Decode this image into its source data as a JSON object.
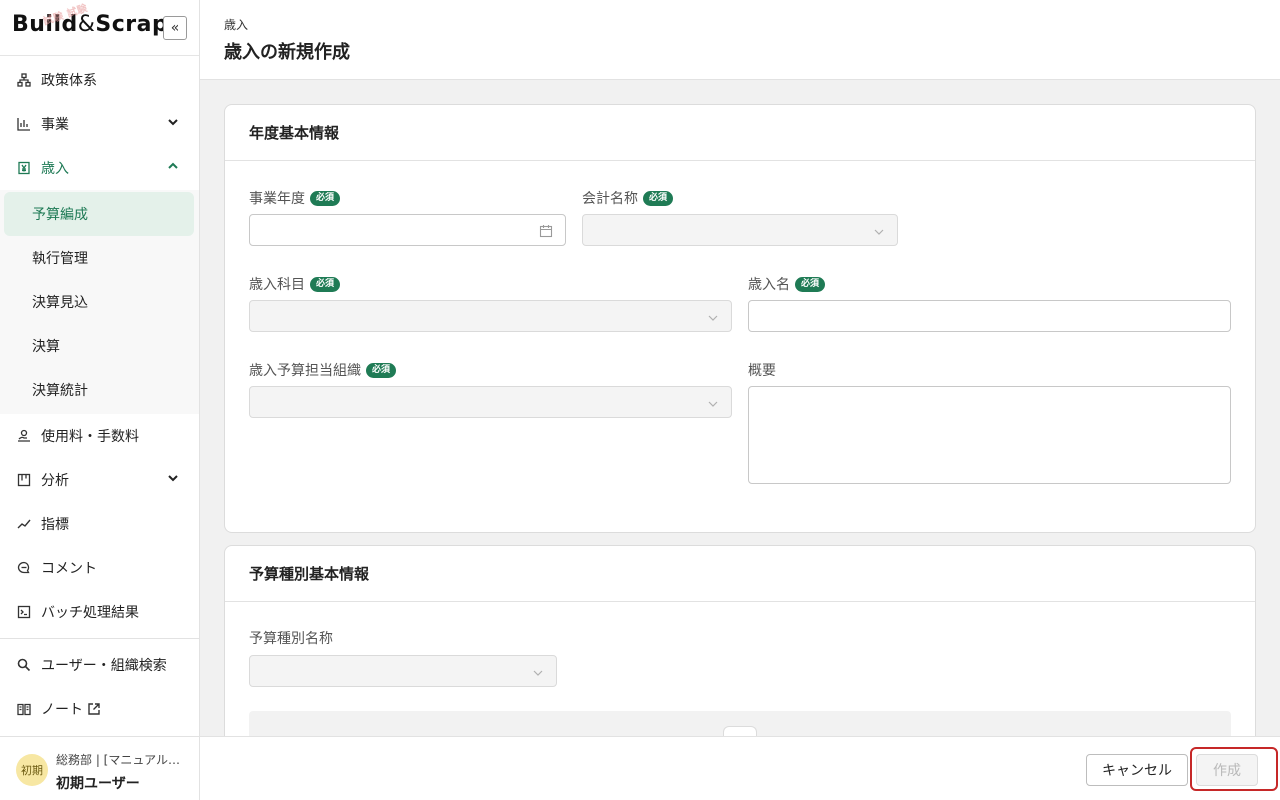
{
  "app": {
    "logo_text_1": "Build",
    "logo_amp": "&",
    "logo_text_2": "Scrap",
    "logo_stamp": "試験 試験",
    "collapse_label": "«"
  },
  "sidebar": {
    "items": [
      {
        "label": "政策体系",
        "icon": "hierarchy-icon"
      },
      {
        "label": "事業",
        "icon": "bar-chart-icon",
        "expandable": true,
        "expanded": false
      },
      {
        "label": "歳入",
        "icon": "yen-document-icon",
        "expandable": true,
        "expanded": true,
        "active": true
      }
    ],
    "sub_items": [
      {
        "label": "予算編成",
        "selected": true
      },
      {
        "label": "執行管理"
      },
      {
        "label": "決算見込"
      },
      {
        "label": "決算"
      },
      {
        "label": "決算統計"
      }
    ],
    "items_after": [
      {
        "label": "使用料・手数料",
        "icon": "hand-coin-icon"
      },
      {
        "label": "分析",
        "icon": "kanban-icon",
        "expandable": true
      },
      {
        "label": "指標",
        "icon": "trend-icon"
      },
      {
        "label": "コメント",
        "icon": "comment-icon"
      },
      {
        "label": "バッチ処理結果",
        "icon": "terminal-icon"
      }
    ],
    "bottom_items": [
      {
        "label": "ユーザー・組織検索",
        "icon": "search-icon"
      },
      {
        "label": "ノート",
        "icon": "book-icon",
        "external": true
      }
    ],
    "user": {
      "avatar_text": "初期",
      "department": "総務部 | [マニュアル…",
      "name": "初期ユーザー"
    }
  },
  "header": {
    "breadcrumb": "歳入",
    "title": "歳入の新規作成"
  },
  "card1": {
    "title": "年度基本情報",
    "required_badge": "必須",
    "fields": {
      "fiscal_year": {
        "label": "事業年度",
        "value": ""
      },
      "account_name": {
        "label": "会計名称",
        "value": ""
      },
      "revenue_item": {
        "label": "歳入科目",
        "value": ""
      },
      "revenue_name": {
        "label": "歳入名",
        "value": ""
      },
      "budget_org": {
        "label": "歳入予算担当組織",
        "value": ""
      },
      "summary": {
        "label": "概要",
        "value": ""
      }
    }
  },
  "card2": {
    "title": "予算種別基本情報",
    "fields": {
      "budget_type_name": {
        "label": "予算種別名称",
        "value": ""
      }
    }
  },
  "footer": {
    "cancel_label": "キャンセル",
    "create_label": "作成"
  },
  "colors": {
    "accent": "#1f7b55",
    "highlight": "#c62828"
  }
}
